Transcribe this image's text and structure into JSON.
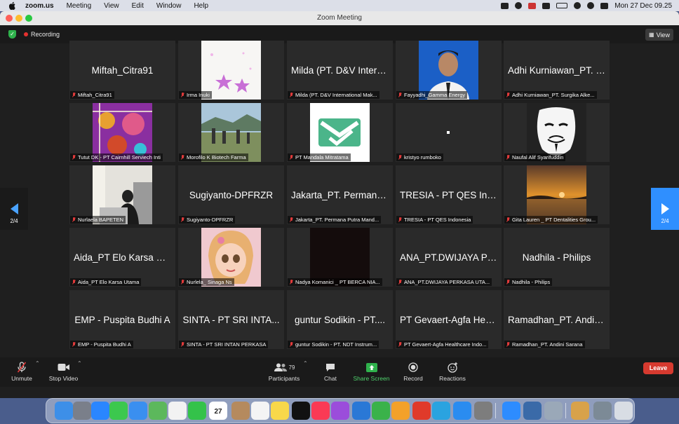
{
  "menubar": {
    "app_name": "zoom.us",
    "menus": [
      "Meeting",
      "View",
      "Edit",
      "Window",
      "Help"
    ],
    "clock": "Mon 27 Dec  09.25",
    "calendar_badge": "27"
  },
  "window": {
    "title": "Zoom Meeting",
    "recording_label": "Recording",
    "view_label": "View"
  },
  "pager": {
    "left_label": "2/4",
    "right_label": "2/4"
  },
  "tiles": [
    {
      "big": "Miftah_Citra91",
      "label": "Miftah_Citra91"
    },
    {
      "big": "",
      "label": "Irma Inuki",
      "picture": "pink-stars"
    },
    {
      "big": "Milda (PT. D&V Intern...",
      "label": "Milda (PT. D&V International Mak..."
    },
    {
      "big": "",
      "label": "Fayyadhi_Gamma Energy",
      "picture": "portrait-blue"
    },
    {
      "big": "Adhi Kurniawan_PT. S...",
      "label": "Adhi Kurniawan_PT. Surgika Alke..."
    },
    {
      "big": "",
      "label": "Tutut DK - PT Cairnhill Serviech Inti",
      "picture": "colorful-spheres"
    },
    {
      "big": "",
      "label": "Morofilo K  Biotech Farma",
      "picture": "group-outdoors"
    },
    {
      "big": "",
      "label": "PT Mandala Mitratama",
      "picture": "green-logo"
    },
    {
      "big": "",
      "label": "kristyo rumboko",
      "picture": "dark-dot"
    },
    {
      "big": "",
      "label": "Naufal Alif Syarifuddin",
      "picture": "mask"
    },
    {
      "big": "",
      "label": "Nurlaela BAPETEN",
      "picture": "office-person"
    },
    {
      "big": "Sugiyanto-DPFRZR",
      "label": "Sugiyanto-DPFRZR"
    },
    {
      "big": "Jakarta_PT. Permana...",
      "label": "Jakarta_PT. Permana Putra Mand..."
    },
    {
      "big": "TRESIA - PT QES Ind...",
      "label": "TRESIA - PT QES Indonesia"
    },
    {
      "big": "",
      "label": "Gita Lauren _ PT Dentalities Grou...",
      "picture": "sunset"
    },
    {
      "big": "Aida_PT Elo Karsa Ut...",
      "label": "Aida_PT Elo Karsa Utama"
    },
    {
      "big": "",
      "label": "Nurlela_ Sinaga Ns",
      "picture": "cartoon-girl"
    },
    {
      "big": "",
      "label": "Nadya Komanici _ PT BERCA NIA...",
      "picture": "black"
    },
    {
      "big": "ANA_PT.DWIJAYA PE...",
      "label": "ANA_PT.DWIJAYA PERKASA UTA..."
    },
    {
      "big": "Nadhila - Philips",
      "label": "Nadhila - Philips"
    },
    {
      "big": "EMP - Puspita Budhi A",
      "label": "EMP - Puspita Budhi A"
    },
    {
      "big": "SINTA - PT SRI INTA...",
      "label": "SINTA - PT SRI INTAN PERKASA"
    },
    {
      "big": "guntur Sodikin - PT....",
      "label": "guntur Sodikin - PT. NDT Instrum..."
    },
    {
      "big": "PT Gevaert-Agfa Heal...",
      "label": "PT Gevaert-Agfa Healthcare Indo..."
    },
    {
      "big": "Ramadhan_PT. Andin...",
      "label": "Ramadhan_PT. Andini Sarana"
    }
  ],
  "toolbar": {
    "unmute": "Unmute",
    "stop_video": "Stop Video",
    "participants": "Participants",
    "participants_count": "79",
    "chat": "Chat",
    "share_screen": "Share Screen",
    "record": "Record",
    "reactions": "Reactions",
    "leave": "Leave"
  },
  "colors": {
    "share_green": "#2fb24c",
    "leave_red": "#d63a2f",
    "pager_blue": "#2f8fff"
  }
}
